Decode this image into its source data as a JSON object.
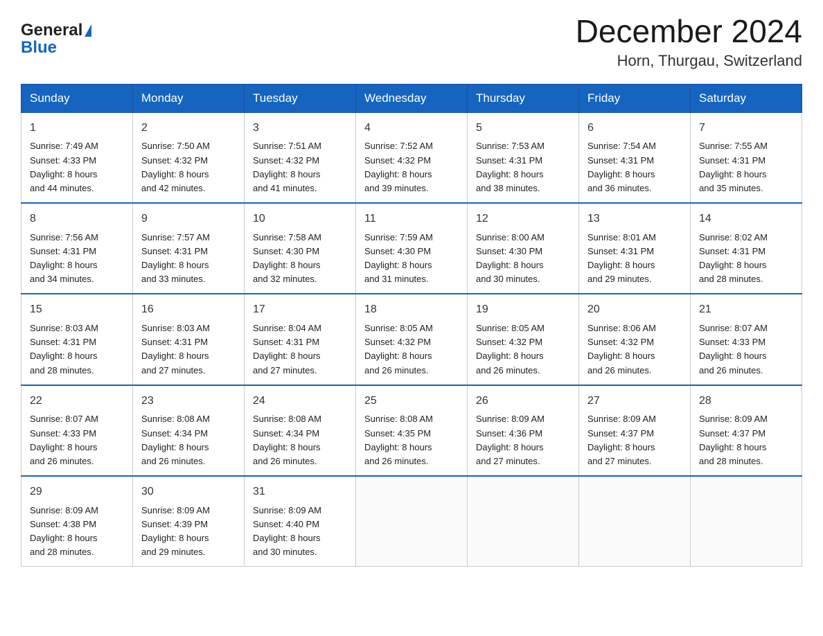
{
  "logo": {
    "line1": "General",
    "line2": "Blue"
  },
  "title": "December 2024",
  "subtitle": "Horn, Thurgau, Switzerland",
  "weekdays": [
    "Sunday",
    "Monday",
    "Tuesday",
    "Wednesday",
    "Thursday",
    "Friday",
    "Saturday"
  ],
  "weeks": [
    [
      {
        "day": "1",
        "info": "Sunrise: 7:49 AM\nSunset: 4:33 PM\nDaylight: 8 hours\nand 44 minutes."
      },
      {
        "day": "2",
        "info": "Sunrise: 7:50 AM\nSunset: 4:32 PM\nDaylight: 8 hours\nand 42 minutes."
      },
      {
        "day": "3",
        "info": "Sunrise: 7:51 AM\nSunset: 4:32 PM\nDaylight: 8 hours\nand 41 minutes."
      },
      {
        "day": "4",
        "info": "Sunrise: 7:52 AM\nSunset: 4:32 PM\nDaylight: 8 hours\nand 39 minutes."
      },
      {
        "day": "5",
        "info": "Sunrise: 7:53 AM\nSunset: 4:31 PM\nDaylight: 8 hours\nand 38 minutes."
      },
      {
        "day": "6",
        "info": "Sunrise: 7:54 AM\nSunset: 4:31 PM\nDaylight: 8 hours\nand 36 minutes."
      },
      {
        "day": "7",
        "info": "Sunrise: 7:55 AM\nSunset: 4:31 PM\nDaylight: 8 hours\nand 35 minutes."
      }
    ],
    [
      {
        "day": "8",
        "info": "Sunrise: 7:56 AM\nSunset: 4:31 PM\nDaylight: 8 hours\nand 34 minutes."
      },
      {
        "day": "9",
        "info": "Sunrise: 7:57 AM\nSunset: 4:31 PM\nDaylight: 8 hours\nand 33 minutes."
      },
      {
        "day": "10",
        "info": "Sunrise: 7:58 AM\nSunset: 4:30 PM\nDaylight: 8 hours\nand 32 minutes."
      },
      {
        "day": "11",
        "info": "Sunrise: 7:59 AM\nSunset: 4:30 PM\nDaylight: 8 hours\nand 31 minutes."
      },
      {
        "day": "12",
        "info": "Sunrise: 8:00 AM\nSunset: 4:30 PM\nDaylight: 8 hours\nand 30 minutes."
      },
      {
        "day": "13",
        "info": "Sunrise: 8:01 AM\nSunset: 4:31 PM\nDaylight: 8 hours\nand 29 minutes."
      },
      {
        "day": "14",
        "info": "Sunrise: 8:02 AM\nSunset: 4:31 PM\nDaylight: 8 hours\nand 28 minutes."
      }
    ],
    [
      {
        "day": "15",
        "info": "Sunrise: 8:03 AM\nSunset: 4:31 PM\nDaylight: 8 hours\nand 28 minutes."
      },
      {
        "day": "16",
        "info": "Sunrise: 8:03 AM\nSunset: 4:31 PM\nDaylight: 8 hours\nand 27 minutes."
      },
      {
        "day": "17",
        "info": "Sunrise: 8:04 AM\nSunset: 4:31 PM\nDaylight: 8 hours\nand 27 minutes."
      },
      {
        "day": "18",
        "info": "Sunrise: 8:05 AM\nSunset: 4:32 PM\nDaylight: 8 hours\nand 26 minutes."
      },
      {
        "day": "19",
        "info": "Sunrise: 8:05 AM\nSunset: 4:32 PM\nDaylight: 8 hours\nand 26 minutes."
      },
      {
        "day": "20",
        "info": "Sunrise: 8:06 AM\nSunset: 4:32 PM\nDaylight: 8 hours\nand 26 minutes."
      },
      {
        "day": "21",
        "info": "Sunrise: 8:07 AM\nSunset: 4:33 PM\nDaylight: 8 hours\nand 26 minutes."
      }
    ],
    [
      {
        "day": "22",
        "info": "Sunrise: 8:07 AM\nSunset: 4:33 PM\nDaylight: 8 hours\nand 26 minutes."
      },
      {
        "day": "23",
        "info": "Sunrise: 8:08 AM\nSunset: 4:34 PM\nDaylight: 8 hours\nand 26 minutes."
      },
      {
        "day": "24",
        "info": "Sunrise: 8:08 AM\nSunset: 4:34 PM\nDaylight: 8 hours\nand 26 minutes."
      },
      {
        "day": "25",
        "info": "Sunrise: 8:08 AM\nSunset: 4:35 PM\nDaylight: 8 hours\nand 26 minutes."
      },
      {
        "day": "26",
        "info": "Sunrise: 8:09 AM\nSunset: 4:36 PM\nDaylight: 8 hours\nand 27 minutes."
      },
      {
        "day": "27",
        "info": "Sunrise: 8:09 AM\nSunset: 4:37 PM\nDaylight: 8 hours\nand 27 minutes."
      },
      {
        "day": "28",
        "info": "Sunrise: 8:09 AM\nSunset: 4:37 PM\nDaylight: 8 hours\nand 28 minutes."
      }
    ],
    [
      {
        "day": "29",
        "info": "Sunrise: 8:09 AM\nSunset: 4:38 PM\nDaylight: 8 hours\nand 28 minutes."
      },
      {
        "day": "30",
        "info": "Sunrise: 8:09 AM\nSunset: 4:39 PM\nDaylight: 8 hours\nand 29 minutes."
      },
      {
        "day": "31",
        "info": "Sunrise: 8:09 AM\nSunset: 4:40 PM\nDaylight: 8 hours\nand 30 minutes."
      },
      {
        "day": "",
        "info": ""
      },
      {
        "day": "",
        "info": ""
      },
      {
        "day": "",
        "info": ""
      },
      {
        "day": "",
        "info": ""
      }
    ]
  ]
}
